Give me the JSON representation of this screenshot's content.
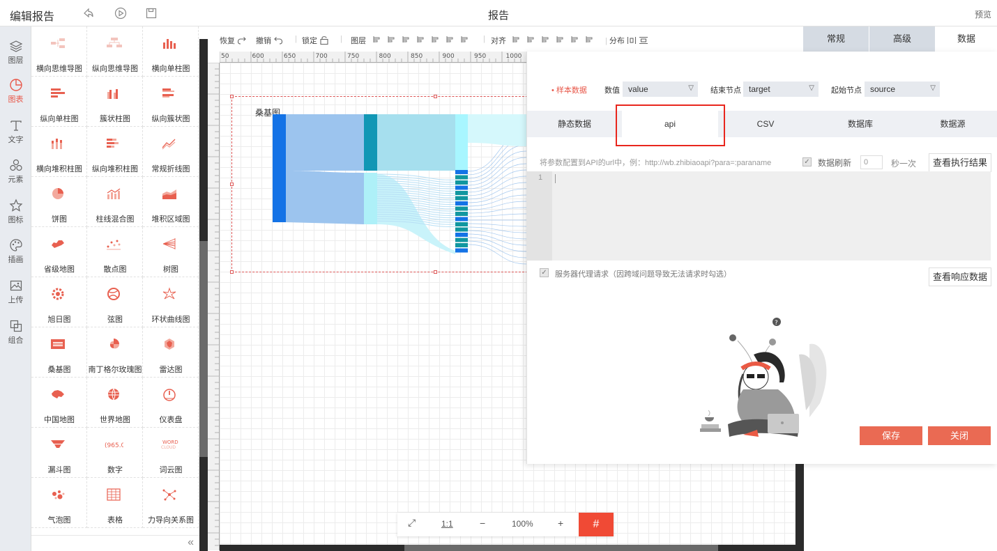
{
  "header": {
    "title": "编辑报告",
    "center_title": "报告",
    "preview_label": "预览"
  },
  "left_nav": [
    {
      "label": "图层",
      "icon": "layers-icon"
    },
    {
      "label": "图表",
      "icon": "chart-icon",
      "active": true
    },
    {
      "label": "文字",
      "icon": "text-icon"
    },
    {
      "label": "元素",
      "icon": "element-icon"
    },
    {
      "label": "图标",
      "icon": "star-icon"
    },
    {
      "label": "插画",
      "icon": "palette-icon"
    },
    {
      "label": "上传",
      "icon": "upload-image-icon"
    },
    {
      "label": "组合",
      "icon": "group-icon"
    }
  ],
  "chart_panel": {
    "items": [
      "横向思维导图",
      "纵向思维导图",
      "横向单柱图",
      "纵向单柱图",
      "簇状柱图",
      "纵向簇状图",
      "横向堆积柱图",
      "纵向堆积柱图",
      "常规折线图",
      "饼图",
      "柱线混合图",
      "堆积区域图",
      "省级地图",
      "散点图",
      "树图",
      "旭日图",
      "弦图",
      "环状曲线图",
      "桑基图",
      "南丁格尔玫瑰图",
      "雷达图",
      "中国地图",
      "世界地图",
      "仪表盘",
      "漏斗图",
      "数字",
      "词云图",
      "气泡图",
      "表格",
      "力导向关系图"
    ],
    "collapse_glyph": "«",
    "number_badge": "965.0",
    "wordcloud_badge": "WORD CLOUD"
  },
  "toolbar": {
    "restore": "恢复",
    "undo": "撤销",
    "lock": "锁定",
    "layer": "图层",
    "align": "对齐",
    "distribute": "分布"
  },
  "ruler": {
    "ticks": [
      "50",
      "600",
      "650",
      "700",
      "750",
      "800",
      "850",
      "900",
      "950",
      "1000"
    ]
  },
  "canvas": {
    "chart_title": "桑基图"
  },
  "zoom": {
    "fit_label": "⤢",
    "ratio_label": "1:1",
    "minus": "−",
    "value": "100%",
    "plus": "+",
    "grid": "#"
  },
  "right_tabs": [
    {
      "label": "常规"
    },
    {
      "label": "高级"
    },
    {
      "label": "数据",
      "selected": true
    }
  ],
  "data_panel": {
    "sample_label": "样本数据",
    "value_label": "数值",
    "value_select": "value",
    "end_label": "结束节点",
    "end_select": "target",
    "start_label": "起始节点",
    "start_select": "source",
    "source_tabs": [
      "静态数据",
      "api",
      "CSV",
      "数据库",
      "数据源"
    ],
    "hint": "将参数配置到API的url中，例：http://wb.zhibiaoapi?para=:paraname",
    "refresh_label": "数据刷新",
    "refresh_value": "0",
    "refresh_unit": "秒一次",
    "view_result_button": "查看执行结果",
    "line_number": "1",
    "proxy_label": "服务器代理请求（因跨域问题导致无法请求时勾选）",
    "view_response_button": "查看响应数据",
    "save_button": "保存",
    "close_button": "关闭"
  },
  "colors": {
    "accent": "#e8584a",
    "icon_red": "#e86050",
    "dark": "#2b2b2b",
    "tab_bg": "#d5dbe3"
  }
}
